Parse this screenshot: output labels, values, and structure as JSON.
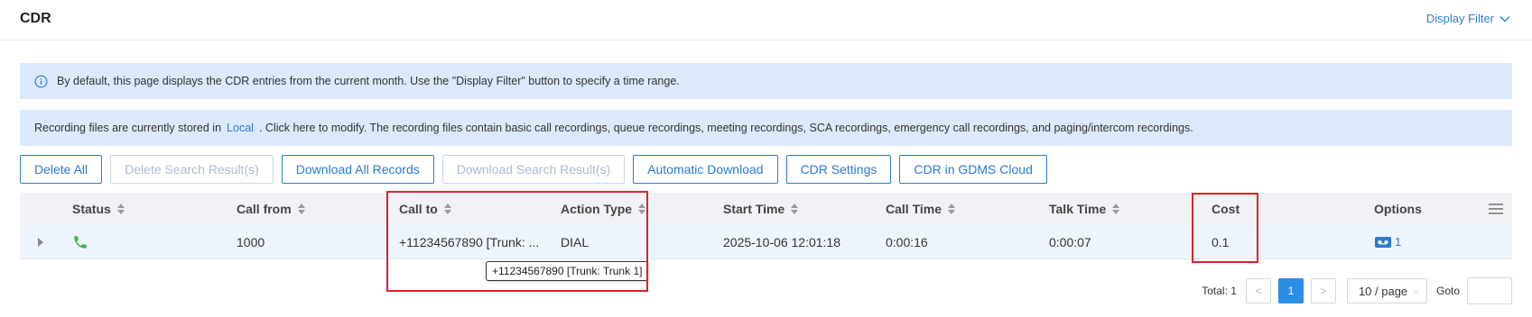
{
  "header": {
    "title": "CDR",
    "display_filter": "Display Filter"
  },
  "info_banner": {
    "text": "By default, this page displays the CDR entries from the current month. Use the \"Display Filter\" button to specify a time range."
  },
  "recording_banner": {
    "prefix": "Recording files are currently stored in",
    "link": "Local",
    "suffix": ". Click here to modify. The recording files contain basic call recordings, queue recordings, meeting recordings, SCA recordings, emergency call recordings, and paging/intercom recordings."
  },
  "toolbar": {
    "delete_all": "Delete All",
    "delete_search": "Delete Search Result(s)",
    "download_all": "Download All Records",
    "download_search": "Download Search Result(s)",
    "auto_download": "Automatic Download",
    "cdr_settings": "CDR Settings",
    "gdms_cloud": "CDR in GDMS Cloud"
  },
  "table": {
    "columns": {
      "status": "Status",
      "call_from": "Call from",
      "call_to": "Call to",
      "action_type": "Action Type",
      "start_time": "Start Time",
      "call_time": "Call Time",
      "talk_time": "Talk Time",
      "cost": "Cost",
      "options": "Options"
    },
    "rows": [
      {
        "status_icon": "phone-answered-icon",
        "call_from": "1000",
        "call_to": "+11234567890 [Trunk: ...",
        "action_type": "DIAL",
        "start_time": "2025-10-06 12:01:18",
        "call_time": "0:00:16",
        "talk_time": "0:00:07",
        "cost": "0.1",
        "options_count": "1"
      }
    ]
  },
  "tooltip": {
    "text": "+11234567890 [Trunk: Trunk 1]"
  },
  "pagination": {
    "total": "Total: 1",
    "prev": "<",
    "current_page": "1",
    "next": ">",
    "page_size": "10 / page",
    "goto": "Goto"
  },
  "colors": {
    "accent": "#2a7bd1",
    "banner_bg": "#dbe9fb",
    "highlight": "#d9232d",
    "phone_green": "#3cb64a"
  }
}
